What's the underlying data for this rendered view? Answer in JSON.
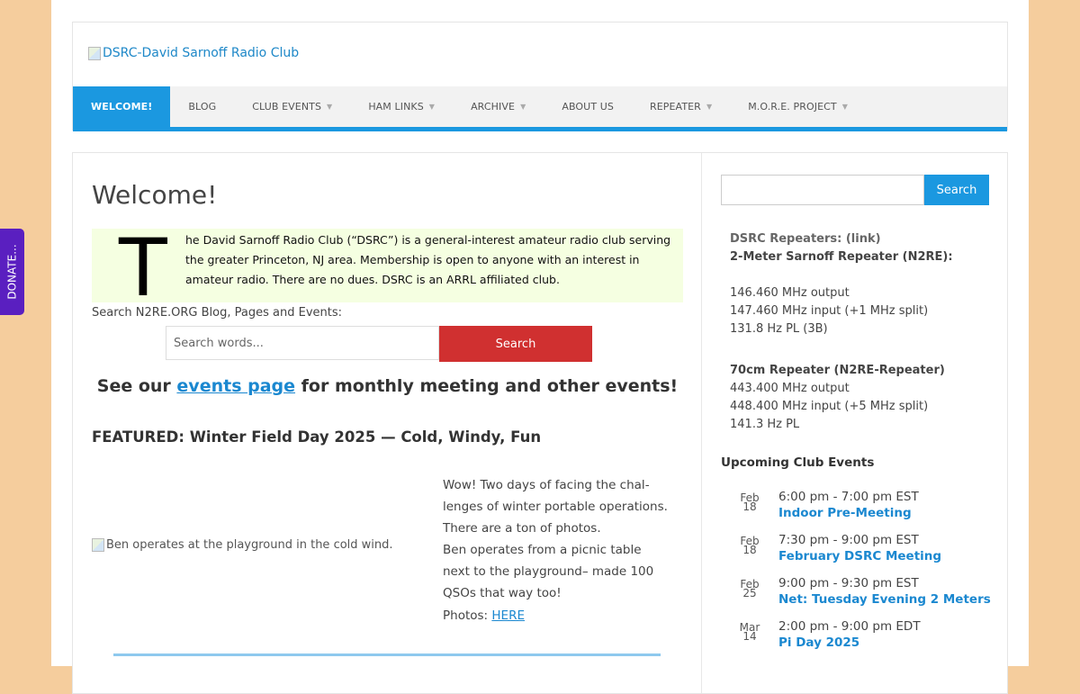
{
  "header": {
    "logo_alt": "DSRC-David Sarnoff Radio Club"
  },
  "nav": {
    "items": [
      {
        "label": "Welcome!",
        "active": true,
        "dropdown": false
      },
      {
        "label": "Blog",
        "active": false,
        "dropdown": false
      },
      {
        "label": "Club Events",
        "active": false,
        "dropdown": true
      },
      {
        "label": "Ham Links",
        "active": false,
        "dropdown": true
      },
      {
        "label": "Archive",
        "active": false,
        "dropdown": true
      },
      {
        "label": "About Us",
        "active": false,
        "dropdown": false
      },
      {
        "label": "Repeater",
        "active": false,
        "dropdown": true
      },
      {
        "label": "M.O.R.E. Project",
        "active": false,
        "dropdown": true
      }
    ]
  },
  "main": {
    "title": "Welcome!",
    "dropcap": "T",
    "intro": "he David Sarnoff Radio Club (“DSRC”) is a general-interest amateur radio club serving the greater Princeton, NJ area. Membership is open to anyone with an interest in amateur radio. There are no dues. DSRC is an ARRL affiliated club.",
    "search_label": "Search N2RE.ORG Blog, Pages and Events:",
    "search_placeholder": "Search words...",
    "search_button": "Search",
    "events_prefix": "See our ",
    "events_link": "events page",
    "events_suffix": " for monthly meeting and other events!",
    "featured_title": "FEATURED: Winter Field Day 2025 — Cold, Windy, Fun",
    "featured_img_alt": "Ben operates at the playground in the cold wind.",
    "featured_p1": "Wow! Two days of facing the chal­lenges of winter portable operations. There are a ton of photos.",
    "featured_p2": "Ben operates from a picnic table next to the playground– made 100 QSOs that way too!",
    "photos_label": "Photos: ",
    "photos_link": "HERE"
  },
  "sidebar": {
    "search_button": "Search",
    "repeaters_head": "DSRC Repeaters: (link)",
    "rep2m_title": "2-Meter Sarnoff Repeater (N2RE):",
    "rep2m_lines": [
      "146.460 MHz output",
      "147.460 MHz input (+1 MHz split)",
      "131.8 Hz PL (3B)"
    ],
    "rep70_title": "70cm Repeater (N2RE-Repeater)",
    "rep70_lines": [
      "443.400 MHz output",
      "448.400 MHz input (+5 MHz split)",
      "141.3 Hz PL"
    ],
    "upcoming_title": "Upcoming Club Events",
    "events": [
      {
        "month": "Feb",
        "day": "18",
        "time": "6:00 pm - 7:00 pm EST",
        "name": "Indoor Pre-Meeting"
      },
      {
        "month": "Feb",
        "day": "18",
        "time": "7:30 pm - 9:00 pm EST",
        "name": "February DSRC Meeting"
      },
      {
        "month": "Feb",
        "day": "25",
        "time": "9:00 pm - 9:30 pm EST",
        "name": "Net: Tuesday Evening 2 Meters"
      },
      {
        "month": "Mar",
        "day": "14",
        "time": "2:00 pm - 9:00 pm EDT",
        "name": "Pi Day 2025"
      }
    ]
  },
  "donate_label": "DONATE..."
}
